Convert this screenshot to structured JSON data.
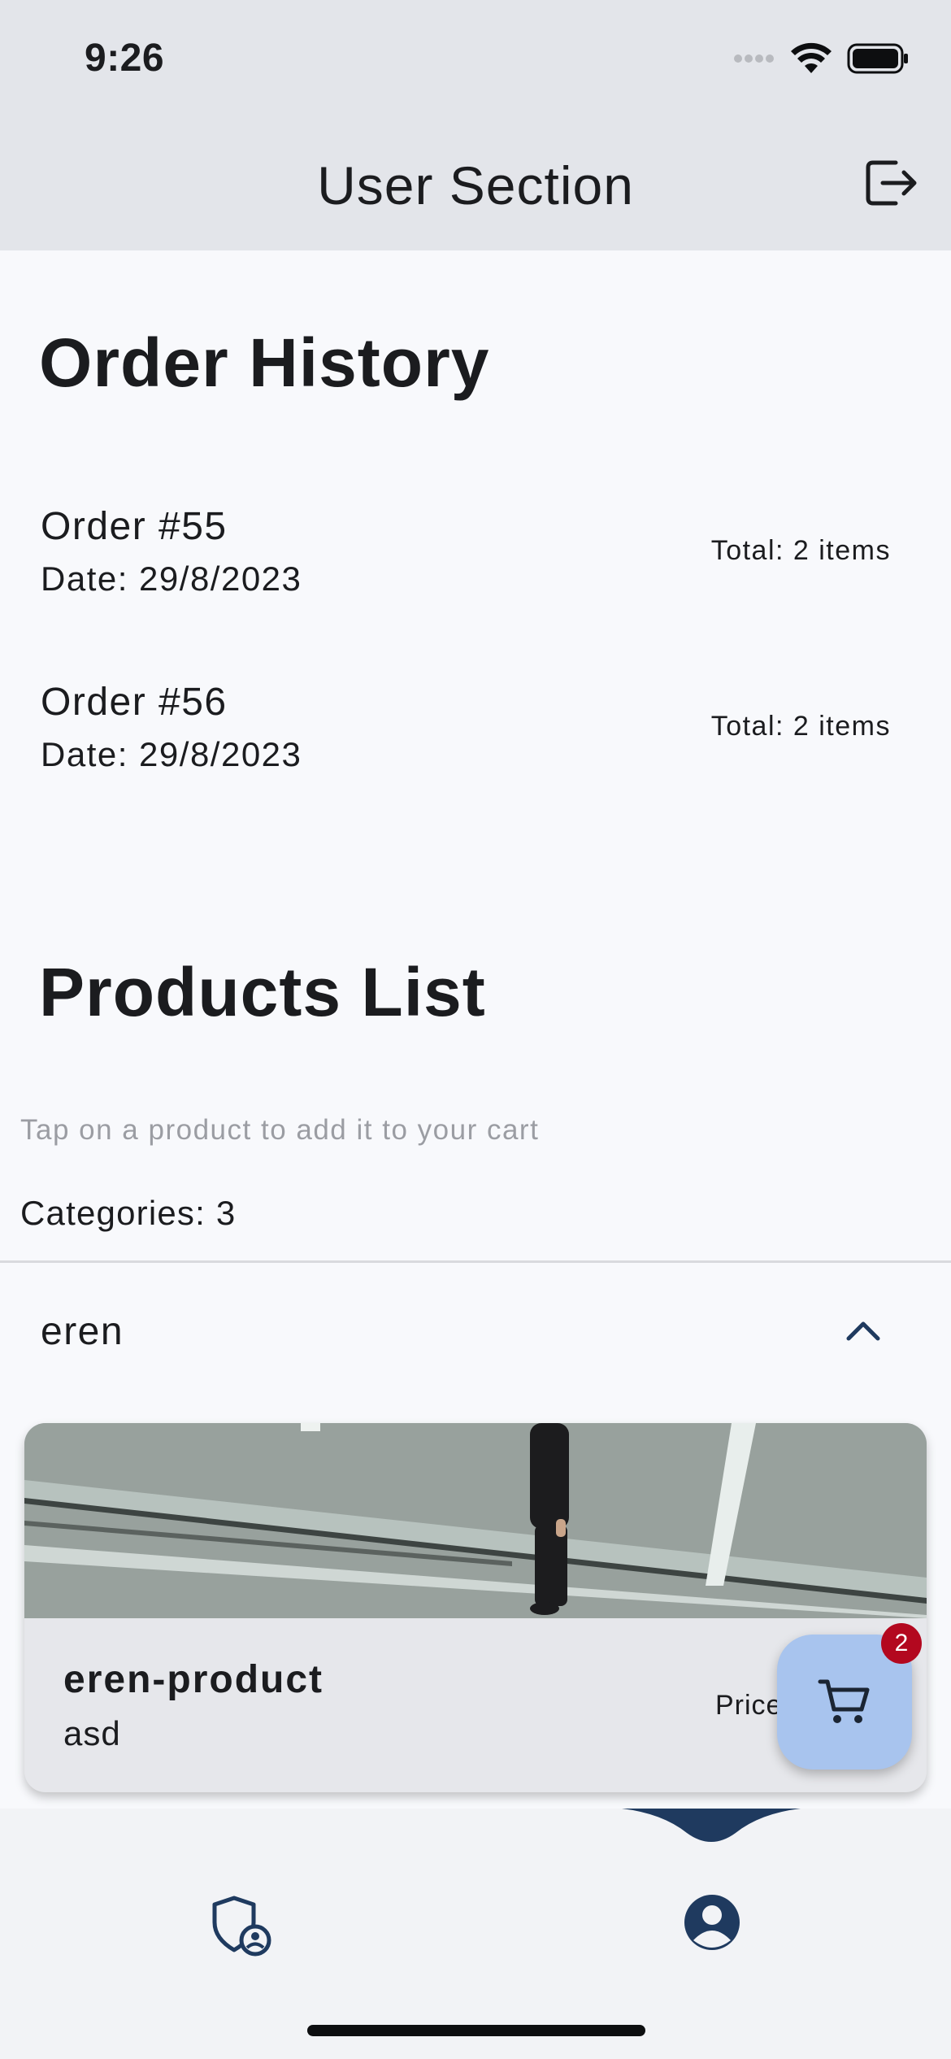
{
  "status_bar": {
    "time": "9:26",
    "icons": [
      "signal-icon",
      "wifi-icon",
      "battery-icon"
    ]
  },
  "app_bar": {
    "title": "User Section",
    "action_icon": "logout-icon"
  },
  "order_history": {
    "title": "Order History",
    "orders": [
      {
        "title": "Order #55",
        "date": "Date: 29/8/2023",
        "total": "Total: 2 items"
      },
      {
        "title": "Order #56",
        "date": "Date: 29/8/2023",
        "total": "Total: 2 items"
      }
    ]
  },
  "products": {
    "title": "Products List",
    "hint": "Tap on a product to add it to your cart",
    "categories_label": "Categories: 3",
    "category": {
      "name": "eren",
      "expanded_icon": "chevron-up-icon",
      "items": [
        {
          "name": "eren-product",
          "description": "asd",
          "price_label": "Price"
        }
      ]
    }
  },
  "cart": {
    "icon": "cart-icon",
    "badge_count": "2"
  },
  "bottom_nav": {
    "items": [
      {
        "icon": "admin-shield-icon"
      },
      {
        "icon": "user-account-icon",
        "active": true
      }
    ]
  },
  "colors": {
    "app_bar_bg": "#e3e5ea",
    "page_bg": "#f8f9fc",
    "fab_bg": "#a8c4ee",
    "badge_bg": "#b3081f",
    "nav_accent": "#1f3a5f"
  }
}
